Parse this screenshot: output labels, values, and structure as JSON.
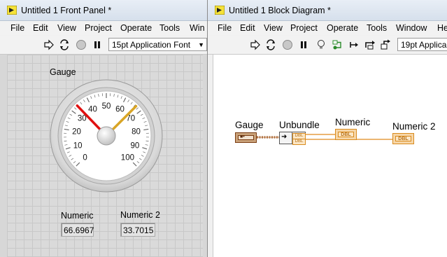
{
  "front_panel": {
    "title": "Untitled 1 Front Panel *",
    "menu": [
      "File",
      "Edit",
      "View",
      "Project",
      "Operate",
      "Tools",
      "Win"
    ],
    "font_selector": "15pt Application Font",
    "gauge": {
      "label": "Gauge",
      "ticks": [
        "0",
        "10",
        "20",
        "30",
        "40",
        "50",
        "60",
        "70",
        "80",
        "90",
        "100"
      ],
      "needle1_value": 33.7015,
      "needle2_value": 66.6967,
      "colors": {
        "needle1": "#e01010",
        "needle2": "#d9a526"
      }
    },
    "numeric": {
      "label": "Numeric",
      "value": "66.6967"
    },
    "numeric2": {
      "label": "Numeric 2",
      "value": "33.7015"
    }
  },
  "block_diagram": {
    "title": "Untitled 1 Block Diagram *",
    "menu": [
      "File",
      "Edit",
      "View",
      "Project",
      "Operate",
      "Tools",
      "Window",
      "He"
    ],
    "font_selector": "19pt Applica",
    "gauge_label": "Gauge",
    "unbundle_label": "Unbundle",
    "numeric_label": "Numeric",
    "numeric2_label": "Numeric 2",
    "dbl_text": "DBL",
    "colors": {
      "cluster_wire": "#8b4513",
      "dbl_wire": "#e08a1e"
    }
  }
}
